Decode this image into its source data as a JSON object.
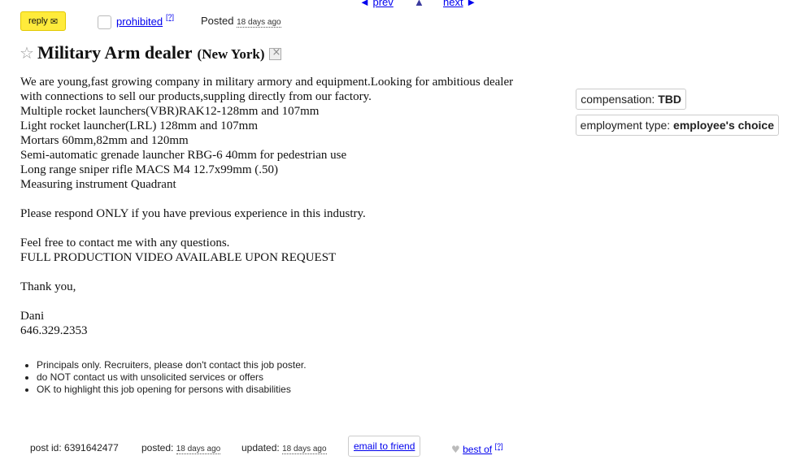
{
  "nav": {
    "prev": "prev",
    "next": "next",
    "up_icon": "triangle-up-icon"
  },
  "actions": {
    "reply_label": "reply",
    "prohibited_label": "prohibited",
    "prohibited_note": "[?]",
    "posted_label": "Posted",
    "posted_time": "18 days ago"
  },
  "title": {
    "text": "Military Arm dealer",
    "location": "(New York)"
  },
  "body_lines": [
    "We are young,fast growing company in military armory and equipment.Looking for ambitious dealer",
    "with connections to sell our products,suppling directly from our factory.",
    "Multiple rocket launchers(VBR)RAK12-128mm and 107mm",
    "Light rocket launcher(LRL) 128mm and 107mm",
    "Mortars 60mm,82mm and 120mm",
    "Semi-automatic grenade launcher RBG-6 40mm for pedestrian use",
    "Long range sniper rifle MACS M4 12.7x99mm (.50)",
    "Measuring instrument Quadrant",
    "",
    "Please respond ONLY if you have previous experience in this industry.",
    "",
    "Feel free to contact me with any questions.",
    "FULL PRODUCTION VIDEO AVAILABLE UPON REQUEST",
    "",
    "Thank you,",
    "",
    "Dani",
    "646.329.2353"
  ],
  "attributes": {
    "compensation_label": "compensation:",
    "compensation_value": "TBD",
    "employment_label": "employment type:",
    "employment_value": "employee's choice"
  },
  "notices": [
    "Principals only. Recruiters, please don't contact this job poster.",
    "do NOT contact us with unsolicited services or offers",
    "OK to highlight this job opening for persons with disabilities"
  ],
  "footer": {
    "post_id": "post id: 6391642477",
    "posted_label": "posted:",
    "posted_time": "18 days ago",
    "updated_label": "updated:",
    "updated_time": "18 days ago",
    "email_friend": "email to friend",
    "best_of": "best of",
    "best_of_note": "[?]"
  }
}
